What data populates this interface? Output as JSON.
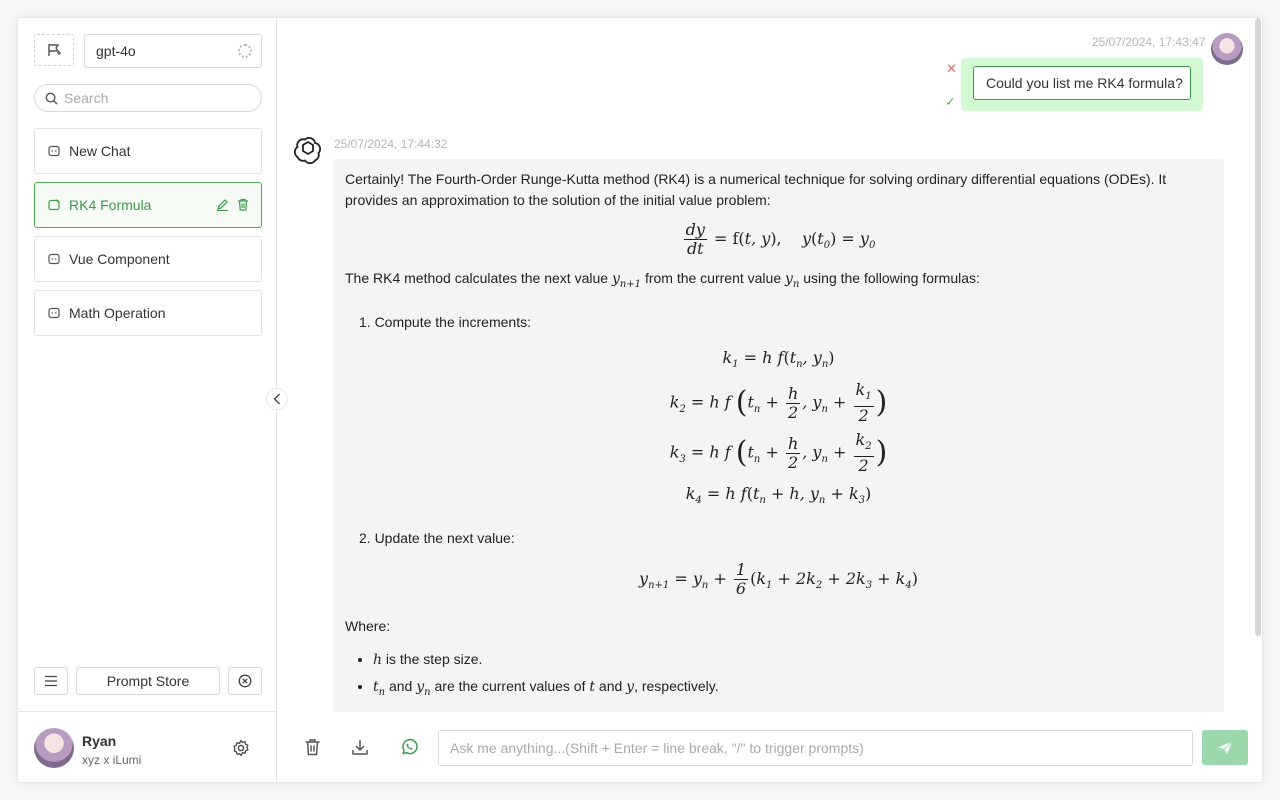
{
  "sidebar": {
    "model": "gpt-4o",
    "search_placeholder": "Search",
    "chats": [
      {
        "label": "New Chat",
        "active": false
      },
      {
        "label": "RK4 Formula",
        "active": true
      },
      {
        "label": "Vue Component",
        "active": false
      },
      {
        "label": "Math Operation",
        "active": false
      }
    ],
    "prompt_store_label": "Prompt Store",
    "user": {
      "name": "Ryan",
      "subtitle": "xyz x iLumi"
    }
  },
  "conversation": {
    "user_message": {
      "timestamp": "25/07/2024, 17:43:47",
      "text": "Could you list me RK4 formula?"
    },
    "bot_message": {
      "timestamp": "25/07/2024, 17:44:32",
      "intro": "Certainly! The Fourth-Order Runge-Kutta method (RK4) is a numerical technique for solving ordinary differential equations (ODEs). It provides an approximation to the solution of the initial value problem:",
      "calc_prefix": "The RK4 method calculates the next value",
      "calc_mid": "from the current value",
      "calc_suffix": "using the following formulas:",
      "step1": "1. Compute the increments:",
      "step2": "2. Update the next value:",
      "where": "Where:",
      "bullet1": "is the step size.",
      "bullet2_and": "and",
      "bullet2_mid": "are the current values of",
      "bullet2_and2": "and",
      "bullet2_end": ", respectively."
    }
  },
  "input": {
    "placeholder": "Ask me anything...(Shift + Enter = line break, \"/\" to trigger prompts)"
  },
  "colors": {
    "accent": "#3a9d4a",
    "user_bubble": "#d2f9d1",
    "bot_bubble": "#f4f4f5",
    "send_button": "#9bd8ac"
  }
}
